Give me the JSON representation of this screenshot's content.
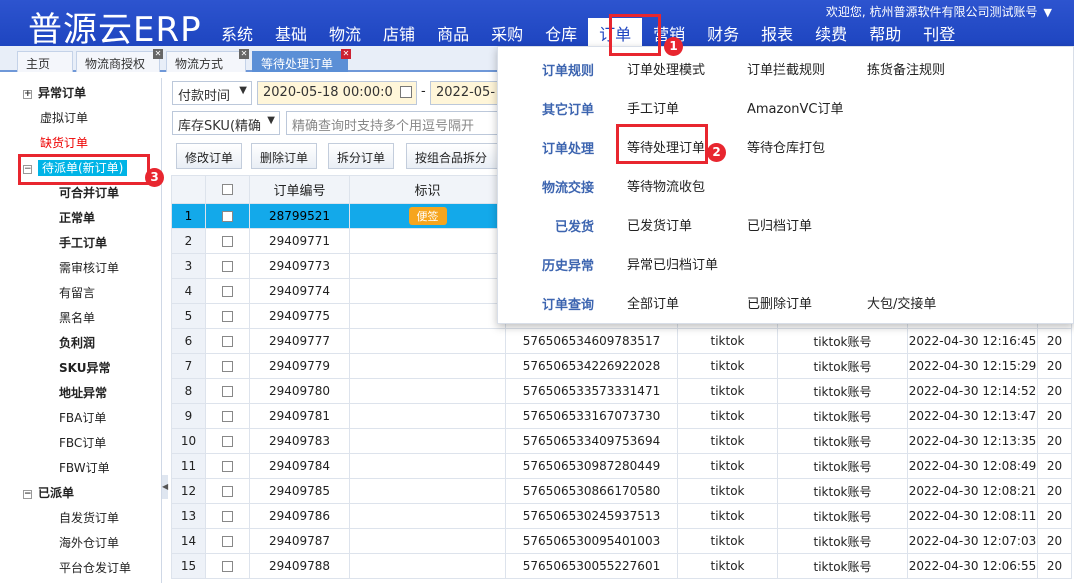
{
  "header": {
    "logo": "普源云ERP",
    "welcome": "欢迎您, 杭州普源软件有限公司测试账号",
    "nav": [
      "系统",
      "基础",
      "物流",
      "店铺",
      "商品",
      "采购",
      "仓库",
      "订单",
      "营销",
      "财务",
      "报表",
      "续费",
      "帮助",
      "刊登"
    ],
    "active_nav": "订单"
  },
  "tabs": [
    {
      "label": "主页"
    },
    {
      "label": "物流商授权"
    },
    {
      "label": "物流方式"
    },
    {
      "label": "等待处理订单"
    }
  ],
  "sidebar": {
    "items": [
      {
        "label": "异常订单"
      },
      {
        "label": "虚拟订单"
      },
      {
        "label": "缺货订单"
      },
      {
        "label": "待派单(新订单)"
      },
      {
        "label": "可合并订单"
      },
      {
        "label": "正常单"
      },
      {
        "label": "手工订单"
      },
      {
        "label": "需审核订单"
      },
      {
        "label": "有留言"
      },
      {
        "label": "黑名单"
      },
      {
        "label": "负利润"
      },
      {
        "label": "SKU异常"
      },
      {
        "label": "地址异常"
      },
      {
        "label": "FBA订单"
      },
      {
        "label": "FBC订单"
      },
      {
        "label": "FBW订单"
      },
      {
        "label": "已派单"
      },
      {
        "label": "自发货订单"
      },
      {
        "label": "海外仓订单"
      },
      {
        "label": "平台仓发订单"
      }
    ],
    "toggle_minus": "−",
    "toggle_plus": "+"
  },
  "filters": {
    "time_type": "付款时间",
    "date_from": "2020-05-18 00:00:0",
    "date_sep": "-",
    "date_to": "2022-05-",
    "sku_type": "库存SKU(精确",
    "search_placeholder": "精确查询时支持多个用逗号隔开"
  },
  "toolbar": {
    "edit_label": "修改订单",
    "delete_label": "删除订单",
    "split_label": "拆分订单",
    "split_combo_label": "按组合品拆分"
  },
  "table": {
    "columns": [
      "",
      "",
      "订单编号",
      "标识"
    ],
    "badge_label": "便签",
    "rows": [
      {
        "n": "1",
        "order": "28799521",
        "platform_no": "",
        "platform": "",
        "account": "",
        "time": ""
      },
      {
        "n": "2",
        "order": "29409771",
        "platform_no": "",
        "platform": "",
        "account": "",
        "time": ""
      },
      {
        "n": "3",
        "order": "29409773",
        "platform_no": "",
        "platform": "",
        "account": "",
        "time": ""
      },
      {
        "n": "4",
        "order": "29409774",
        "platform_no": "",
        "platform": "",
        "account": "",
        "time": ""
      },
      {
        "n": "5",
        "order": "29409775",
        "platform_no": "",
        "platform": "",
        "account": "",
        "time": ""
      },
      {
        "n": "6",
        "order": "29409777",
        "platform_no": "576506534609783517",
        "platform": "tiktok",
        "account": "tiktok账号",
        "time": "2022-04-30 12:16:45"
      },
      {
        "n": "7",
        "order": "29409779",
        "platform_no": "576506534226922028",
        "platform": "tiktok",
        "account": "tiktok账号",
        "time": "2022-04-30 12:15:29"
      },
      {
        "n": "8",
        "order": "29409780",
        "platform_no": "576506533573331471",
        "platform": "tiktok",
        "account": "tiktok账号",
        "time": "2022-04-30 12:14:52"
      },
      {
        "n": "9",
        "order": "29409781",
        "platform_no": "576506533167073730",
        "platform": "tiktok",
        "account": "tiktok账号",
        "time": "2022-04-30 12:13:47"
      },
      {
        "n": "10",
        "order": "29409783",
        "platform_no": "576506533409753694",
        "platform": "tiktok",
        "account": "tiktok账号",
        "time": "2022-04-30 12:13:35"
      },
      {
        "n": "11",
        "order": "29409784",
        "platform_no": "576506530987280449",
        "platform": "tiktok",
        "account": "tiktok账号",
        "time": "2022-04-30 12:08:49"
      },
      {
        "n": "12",
        "order": "29409785",
        "platform_no": "576506530866170580",
        "platform": "tiktok",
        "account": "tiktok账号",
        "time": "2022-04-30 12:08:21"
      },
      {
        "n": "13",
        "order": "29409786",
        "platform_no": "576506530245937513",
        "platform": "tiktok",
        "account": "tiktok账号",
        "time": "2022-04-30 12:08:11"
      },
      {
        "n": "14",
        "order": "29409787",
        "platform_no": "576506530095401003",
        "platform": "tiktok",
        "account": "tiktok账号",
        "time": "2022-04-30 12:07:03"
      },
      {
        "n": "15",
        "order": "29409788",
        "platform_no": "576506530055227601",
        "platform": "tiktok",
        "account": "tiktok账号",
        "time": "2022-04-30 12:06:55"
      }
    ],
    "trail": "20"
  },
  "dropdown": {
    "sections": [
      {
        "category": "订单规则",
        "items": [
          "订单处理模式",
          "订单拦截规则",
          "拣货备注规则"
        ]
      },
      {
        "category": "其它订单",
        "items": [
          "手工订单",
          "AmazonVC订单"
        ]
      },
      {
        "category": "订单处理",
        "items": [
          "等待处理订单",
          "等待仓库打包"
        ]
      },
      {
        "category": "物流交接",
        "items": [
          "等待物流收包"
        ]
      },
      {
        "category": "已发货",
        "items": [
          "已发货订单",
          "已归档订单"
        ]
      },
      {
        "category": "历史异常",
        "items": [
          "异常已归档订单"
        ]
      },
      {
        "category": "订单查询",
        "items": [
          "全部订单",
          "已删除订单",
          "大包/交接单"
        ]
      }
    ]
  },
  "annotations": {
    "markers": [
      "1",
      "2",
      "3"
    ],
    "color": "#e8262f"
  },
  "colors": {
    "header_blue": "#1e45c0",
    "selected_row": "#13a9ea",
    "badge_orange": "#f6a51e",
    "category_blue": "#3d65b0"
  }
}
